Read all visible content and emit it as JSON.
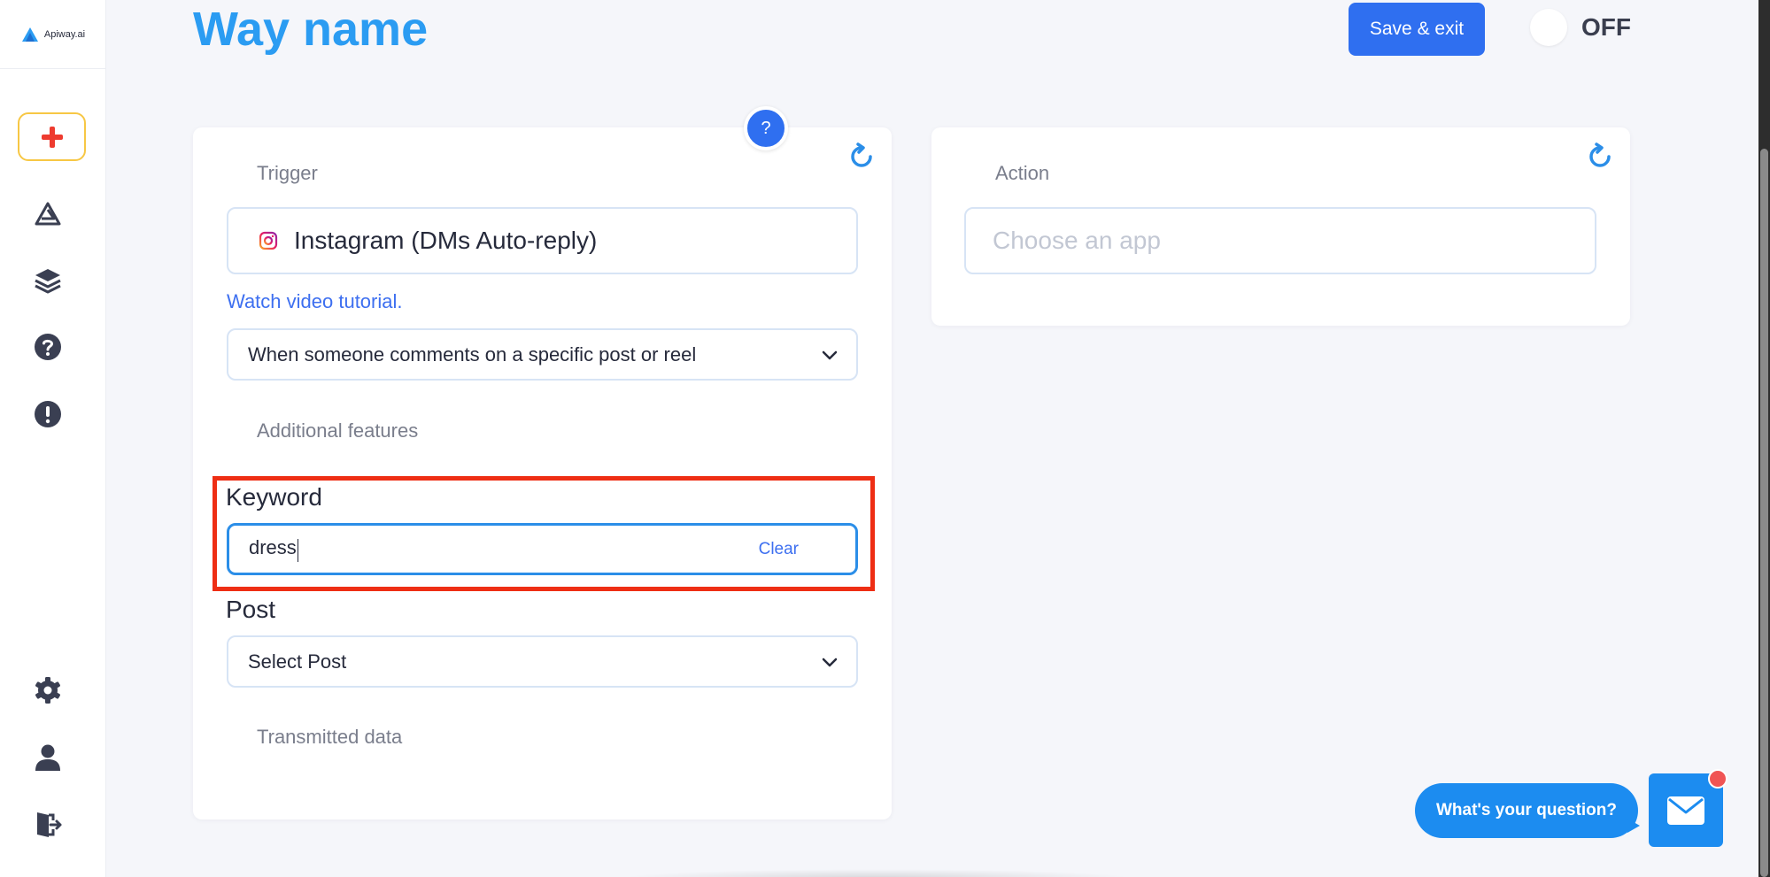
{
  "brand": {
    "name": "Apiway.ai",
    "accent": "#2b9cf2",
    "primary_button": "#2f6ff0",
    "highlight": "#ee2e14",
    "create_border": "#f7c744"
  },
  "sidebar": {
    "items": [
      {
        "name": "create",
        "icon": "plus-icon"
      },
      {
        "name": "ways",
        "icon": "apiway-logo-icon"
      },
      {
        "name": "layers",
        "icon": "layers-icon"
      },
      {
        "name": "help",
        "icon": "question-circle-icon"
      },
      {
        "name": "alerts",
        "icon": "exclamation-circle-icon"
      },
      {
        "name": "settings",
        "icon": "gear-icon"
      },
      {
        "name": "profile",
        "icon": "user-icon"
      },
      {
        "name": "logout",
        "icon": "logout-icon"
      }
    ]
  },
  "header": {
    "title": "Way name",
    "save_label": "Save & exit",
    "toggle_state": "OFF"
  },
  "trigger": {
    "section_label": "Trigger",
    "help_label": "?",
    "app_name": "Instagram (DMs Auto-reply)",
    "tutorial_link": "Watch video tutorial.",
    "event_value": "When someone comments on a specific post or reel",
    "additional_label": "Additional features",
    "keyword_label": "Keyword",
    "keyword_value": "dress",
    "clear_label": "Clear",
    "post_label": "Post",
    "post_placeholder": "Select Post",
    "transmitted_label": "Transmitted data"
  },
  "action": {
    "section_label": "Action",
    "app_placeholder": "Choose an app"
  },
  "chat": {
    "prompt": "What's your question?"
  }
}
